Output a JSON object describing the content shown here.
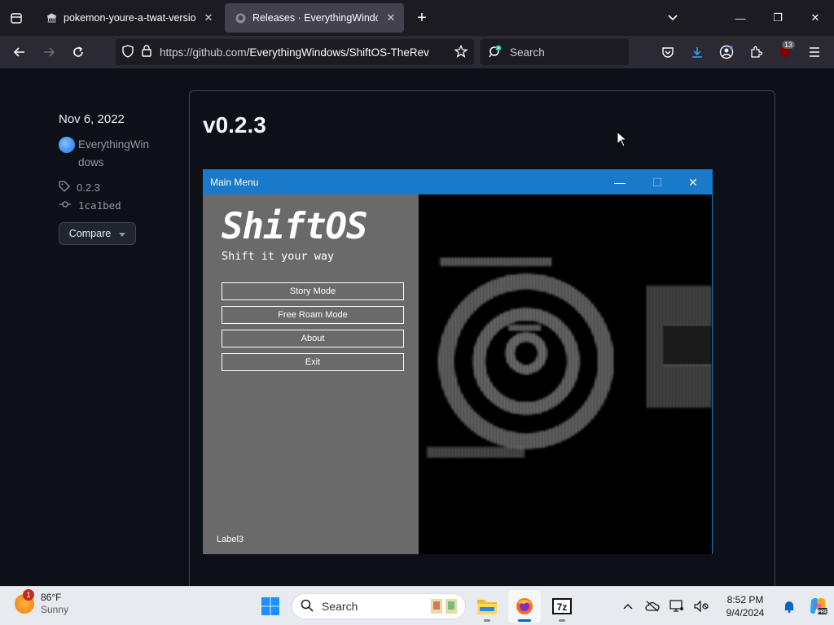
{
  "browser": {
    "tabs": [
      {
        "title": "pokemon-youre-a-twat-version",
        "active": false
      },
      {
        "title": "Releases · EverythingWindows/",
        "active": true
      }
    ],
    "url_host": "https://github.com",
    "url_path": "/EverythingWindows/ShiftOS-TheRev",
    "search_placeholder": "Search",
    "extension_badge": "13"
  },
  "release": {
    "date": "Nov 6, 2022",
    "author_line1": "EverythingWin",
    "author_line2": "dows",
    "tag": "0.2.3",
    "commit": "1ca1bed",
    "compare_label": "Compare",
    "version_title": "v0.2.3"
  },
  "screenshot": {
    "window_title": "Main Menu",
    "logo": "ShiftOS",
    "tagline": "Shift it your way",
    "buttons": [
      "Story Mode",
      "Free Roam Mode",
      "About",
      "Exit"
    ],
    "label": "Label3"
  },
  "taskbar": {
    "weather_temp": "86°F",
    "weather_desc": "Sunny",
    "weather_badge": "1",
    "search_label": "Search",
    "time": "8:52 PM",
    "date": "9/4/2024"
  },
  "colors": {
    "page_bg": "#0d1117",
    "accent_blue": "#1979ca",
    "taskbar_bg": "#e7eaef"
  }
}
